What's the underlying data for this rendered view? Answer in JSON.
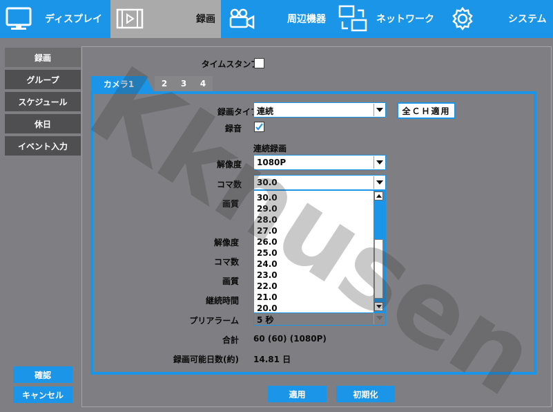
{
  "nav": {
    "display": "ディスプレイ",
    "record": "録画",
    "peripherals": "周辺機器",
    "network": "ネットワーク",
    "system": "システム"
  },
  "sidebar": {
    "items": [
      {
        "label": "録画"
      },
      {
        "label": "グループ"
      },
      {
        "label": "スケジュール"
      },
      {
        "label": "休日"
      },
      {
        "label": "イベント入力"
      }
    ],
    "ok_label": "確認",
    "cancel_label": "キャンセル"
  },
  "timestamp": {
    "label": "タイムスタンプ",
    "checked": false
  },
  "tabs": [
    "カメラ1",
    "2",
    "3",
    "4"
  ],
  "form": {
    "record_type_label": "録画タイプ",
    "record_type_value": "連続",
    "apply_all_label": "全ＣＨ適用",
    "audio_label": "録音",
    "audio_checked": true,
    "continuous_header": "連続録画",
    "resolution_label": "解像度",
    "resolution_value": "1080P",
    "fps_label": "コマ数",
    "fps_value": "30.0",
    "quality_label": "画質",
    "resolution2_label": "解像度",
    "fps2_label": "コマ数",
    "quality2_label": "画質",
    "duration_label": "継続時間",
    "prealarm_label": "プリアラーム",
    "prealarm_value": "5 秒",
    "total_label": "合計",
    "total_value": "60 (60) (1080P)",
    "days_label": "録画可能日数(約)",
    "days_value": "14.81 日"
  },
  "fps_options": [
    "30.0",
    "29.0",
    "28.0",
    "27.0",
    "26.0",
    "25.0",
    "24.0",
    "23.0",
    "22.0",
    "21.0",
    "20.0"
  ],
  "footer": {
    "apply_label": "適用",
    "default_label": "初期化"
  },
  "watermark": "Kknusen",
  "colors": {
    "accent": "#1a95e8",
    "background": "#7f7e82"
  }
}
